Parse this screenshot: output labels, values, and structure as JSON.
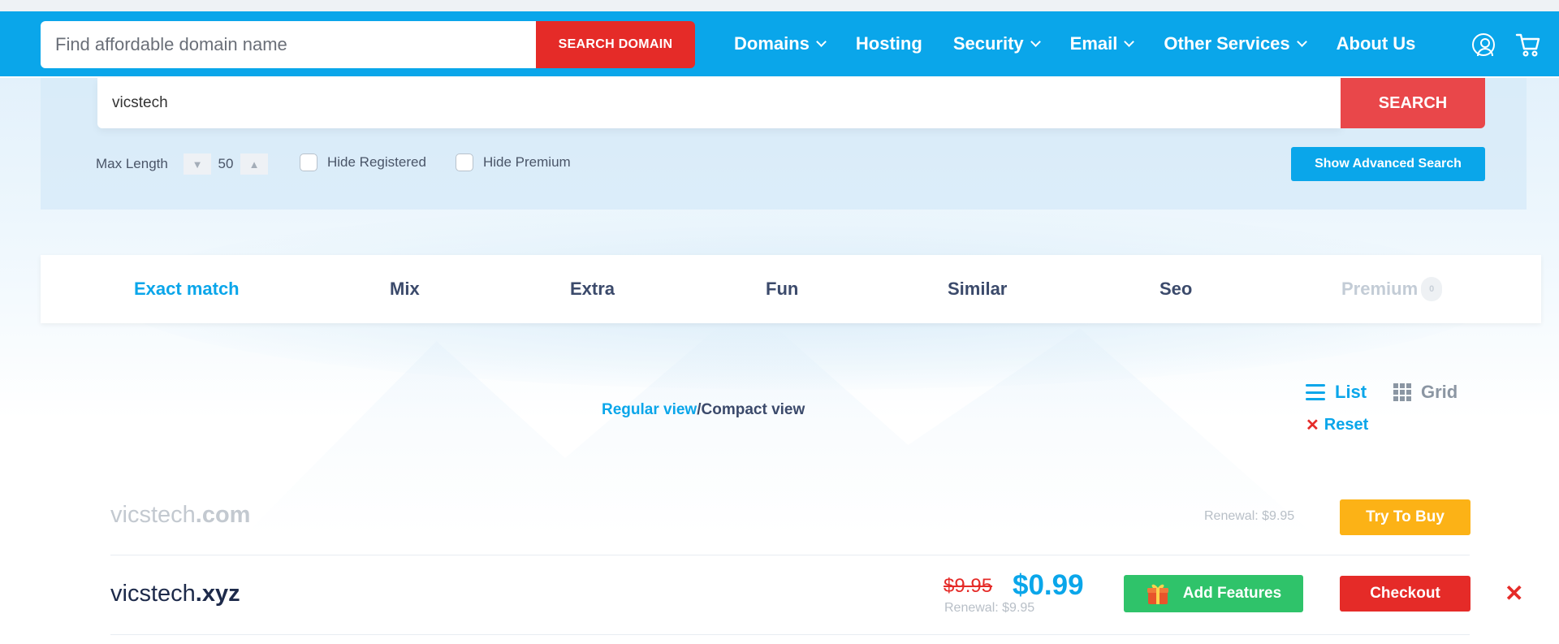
{
  "header": {
    "search_placeholder": "Find affordable domain name",
    "search_button": "SEARCH DOMAIN",
    "nav": [
      {
        "label": "Domains",
        "has_dropdown": true
      },
      {
        "label": "Hosting",
        "has_dropdown": false
      },
      {
        "label": "Security",
        "has_dropdown": true
      },
      {
        "label": "Email",
        "has_dropdown": true
      },
      {
        "label": "Other Services",
        "has_dropdown": true
      },
      {
        "label": "About Us",
        "has_dropdown": false
      }
    ],
    "icons": [
      "user-icon",
      "cart-icon"
    ]
  },
  "search": {
    "value": "vicstech",
    "button": "SEARCH",
    "max_length_label": "Max Length",
    "max_length_value": "50",
    "hide_registered": "Hide Registered",
    "hide_premium": "Hide Premium",
    "advanced_button": "Show Advanced Search"
  },
  "tabs": [
    {
      "label": "Exact match",
      "state": "active"
    },
    {
      "label": "Mix",
      "state": "normal"
    },
    {
      "label": "Extra",
      "state": "normal"
    },
    {
      "label": "Fun",
      "state": "normal"
    },
    {
      "label": "Similar",
      "state": "normal"
    },
    {
      "label": "Seo",
      "state": "normal"
    },
    {
      "label": "Premium",
      "state": "disabled",
      "badge": "0"
    }
  ],
  "views": {
    "regular": "Regular view",
    "separator": "/",
    "compact": "Compact view",
    "list": "List",
    "grid": "Grid",
    "reset": "Reset"
  },
  "results": [
    {
      "name": "vicstech",
      "tld": ".com",
      "status": "taken",
      "renewal": "Renewal: $9.95",
      "action": "Try To Buy"
    },
    {
      "name": "vicstech",
      "tld": ".xyz",
      "status": "available",
      "old_price": "$9.95",
      "price": "$0.99",
      "renewal": "Renewal: $9.95",
      "features": "Add Features",
      "action": "Checkout"
    }
  ],
  "colors": {
    "brand_blue": "#0aa6ea",
    "red": "#e52b28",
    "yellow": "#fcb216",
    "green": "#2fc36a"
  }
}
